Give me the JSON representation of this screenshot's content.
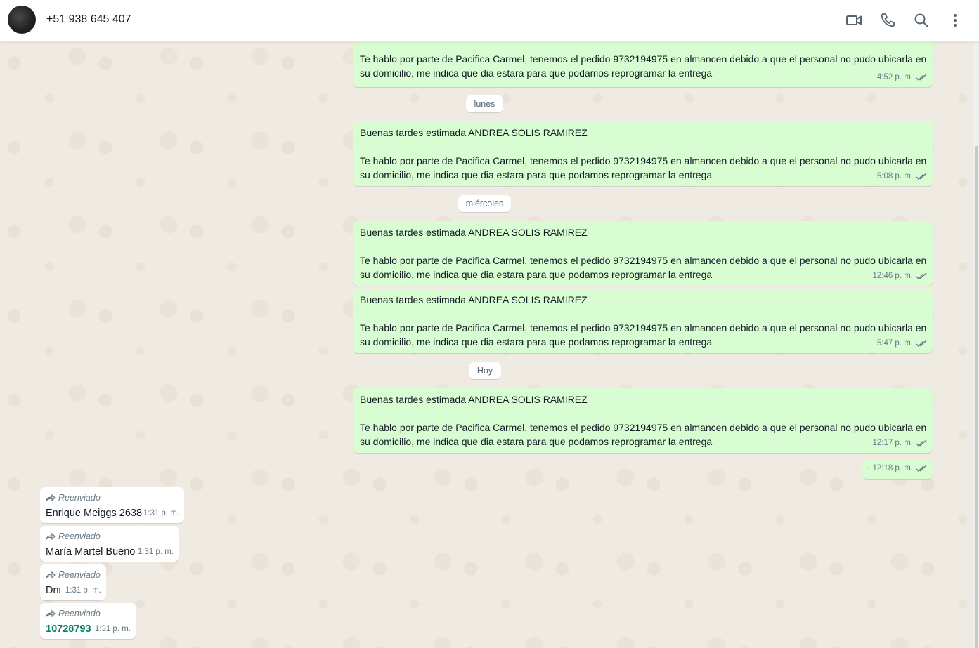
{
  "header": {
    "contact_name": "+51 938 645 407",
    "icons": [
      "video-call-icon",
      "voice-call-icon",
      "search-icon",
      "menu-icon"
    ]
  },
  "colors": {
    "outgoing_bubble": "#d9fdd3",
    "incoming_bubble": "#ffffff",
    "chat_background": "#efeae2",
    "tick_blue_gray": "#667781",
    "link_green": "#06826a"
  },
  "messages": {
    "m1": {
      "text": "Te hablo por parte de Pacifica Carmel, tenemos el pedido 9732194975 en almancen debido a que el personal no pudo ubicarla en su domicilio, me indica que dia estara para que podamos reprogramar la entrega",
      "time": "4:52 p. m."
    },
    "day1": "lunes",
    "m2": {
      "text": "Buenas tardes estimada ANDREA SOLIS RAMIREZ\n\nTe hablo por parte de Pacifica Carmel, tenemos el pedido 9732194975 en almancen debido a que el personal no pudo ubicarla en su domicilio, me indica que dia estara para que podamos reprogramar la entrega",
      "time": "5:08 p. m."
    },
    "day2": "miércoles",
    "m3": {
      "text": "Buenas tardes estimada ANDREA SOLIS RAMIREZ\n\nTe hablo por parte de Pacifica Carmel, tenemos el pedido 9732194975 en almancen debido a que el personal no pudo ubicarla en su domicilio, me indica que dia estara para que podamos reprogramar la entrega",
      "time": "12:46 p. m."
    },
    "m4": {
      "text": "Buenas tardes estimada ANDREA SOLIS RAMIREZ\n\nTe hablo por parte de Pacifica Carmel, tenemos el pedido 9732194975 en almancen debido a que el personal no pudo ubicarla en su domicilio, me indica que dia estara para que podamos reprogramar la entrega",
      "time": "5:47 p. m."
    },
    "day3": "Hoy",
    "m5": {
      "text": "Buenas tardes estimada ANDREA SOLIS RAMIREZ\n\nTe hablo por parte de Pacifica Carmel, tenemos el pedido 9732194975 en almancen debido a que el personal no pudo ubicarla en su domicilio, me indica que dia estara para que podamos reprogramar la entrega",
      "time": "12:17 p. m."
    },
    "m6": {
      "text": "·",
      "time": "12:18 p. m."
    },
    "in1": {
      "forwarded": "Reenviado",
      "text": "Enrique Meiggs 2638",
      "time": "1:31 p. m."
    },
    "in2": {
      "forwarded": "Reenviado",
      "text": "María Martel Bueno",
      "time": "1:31 p. m."
    },
    "in3": {
      "forwarded": "Reenviado",
      "text": "Dni",
      "time": "1:31 p. m."
    },
    "in4": {
      "forwarded": "Reenviado",
      "text": "10728793",
      "time": "1:31 p. m."
    }
  }
}
